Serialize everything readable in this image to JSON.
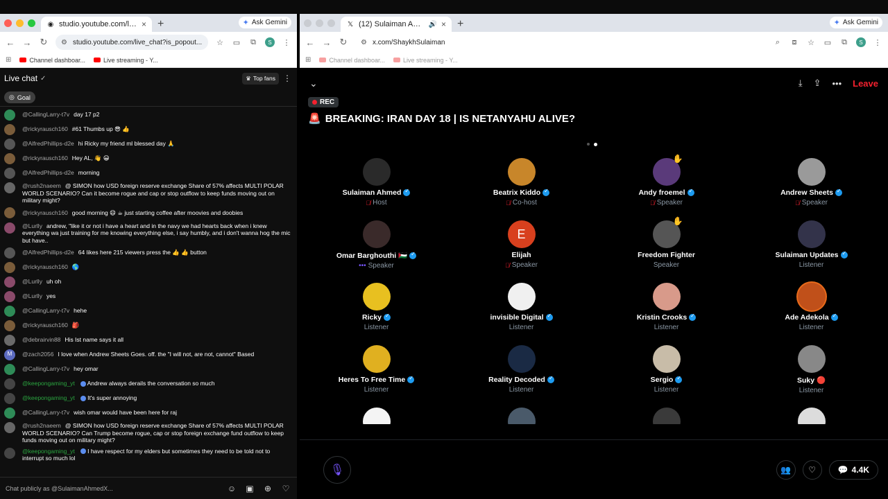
{
  "left_window": {
    "tab": {
      "title": "studio.youtube.com/live_cha",
      "close": "×"
    },
    "new_tab": "+",
    "gemini": "Ask Gemini",
    "url": "studio.youtube.com/live_chat?is_popout...",
    "bookmarks": [
      "Channel dashboar...",
      "Live streaming - Y..."
    ]
  },
  "right_window": {
    "tab": {
      "title": "(12) Sulaiman Ahmed (@S",
      "close": "×"
    },
    "new_tab": "+",
    "gemini": "Ask Gemini",
    "url": "x.com/ShaykhSulaiman",
    "bookmarks": [
      "Channel dashboar...",
      "Live streaming - Y..."
    ]
  },
  "chat": {
    "title": "Live chat",
    "top_fans": "Top fans",
    "goal": "Goal",
    "input_placeholder": "Chat publicly as @SulaimanAhmedX...",
    "badge_count": "1",
    "messages": [
      {
        "author": "@CallingLarry-t7v",
        "text": "day 17 p2",
        "color": "#2e8b57"
      },
      {
        "author": "@rickyrausch160",
        "text": "#61 Thumbs up 😎 👍",
        "color": "#7a5c3a"
      },
      {
        "author": "@AlfredPhillips-d2e",
        "text": "hi Ricky my friend ml blessed day 🙏",
        "color": "#555"
      },
      {
        "author": "@rickyrausch160",
        "text": "Hey AL, 👋 😀",
        "color": "#7a5c3a"
      },
      {
        "author": "@AlfredPhillips-d2e",
        "text": "morning",
        "color": "#555"
      },
      {
        "author": "@rush2naeem",
        "text": "@ SIMON how USD foreign reserve exchange Share of 57% affects MULTI POLAR WORLD SCENARIO? Can it become rogue and cap or stop outflow to keep funds moving out on military might?",
        "color": "#666",
        "tall": true
      },
      {
        "author": "@rickyrausch160",
        "text": "good morning 😄 ☕ just starting coffee after moovies and doobies",
        "color": "#7a5c3a"
      },
      {
        "author": "@Lurlly",
        "text": "andrew, \"like it or not i have a heart and in the navy we had hearts back when i knew everything wa just training for me knowing everything else, i say humbly, and i don't wanna hog the mic but have..",
        "color": "#8a4a6a",
        "tall": true
      },
      {
        "author": "@AlfredPhillips-d2e",
        "text": "64 likes here 215 viewers press the 👍 👍 button",
        "color": "#555"
      },
      {
        "author": "@rickyrausch160",
        "text": "🌎",
        "color": "#7a5c3a"
      },
      {
        "author": "@Lurlly",
        "text": "uh oh",
        "color": "#8a4a6a"
      },
      {
        "author": "@Lurlly",
        "text": "yes",
        "color": "#8a4a6a"
      },
      {
        "author": "@CallingLarry-t7v",
        "text": "hehe",
        "color": "#2e8b57"
      },
      {
        "author": "@rickyrausch160",
        "text": "🎒",
        "color": "#7a5c3a"
      },
      {
        "author": "@debrairvin88",
        "text": "His Ist name says it all",
        "color": "#6a6a6a"
      },
      {
        "author": "@zach2056",
        "text": "I love when Andrew Sheets Goes. off. the \"I will not, are not, cannot\" Based",
        "color": "#5c6bc0",
        "initial": "M"
      },
      {
        "author": "@CallingLarry-t7v",
        "text": "hey omar",
        "color": "#2e8b57"
      },
      {
        "author": "@keepongaming_yt",
        "text": "Andrew always derails the conversation so much",
        "color": "#444",
        "green": true
      },
      {
        "author": "@keepongaming_yt",
        "text": "It's super annoying",
        "color": "#444",
        "green": true
      },
      {
        "author": "@CallingLarry-t7v",
        "text": "wish omar would have been here for raj",
        "color": "#2e8b57"
      },
      {
        "author": "@rush2naeem",
        "text": "@ SIMON how USD foreign reserve exchange Share of 57% affects MULTI POLAR WORLD SCENARIO? Can Trump become rogue, cap or stop foreign exchange fund outflow to keep funds moving out on military might?",
        "color": "#666",
        "tall": true
      },
      {
        "author": "@keepongaming_yt",
        "text": "I have respect for my elders but sometimes they need to be told not to interrupt so much lol",
        "color": "#444",
        "green": true,
        "tall": true
      }
    ]
  },
  "space": {
    "rec": "REC",
    "leave": "Leave",
    "title": "BREAKING: IRAN DAY 18 | IS NETANYAHU ALIVE?",
    "title_emoji": "🚨",
    "listener_count": "4.4K",
    "people": [
      {
        "name": "Sulaiman Ahmed",
        "role": "Host",
        "verified": true,
        "muted": true,
        "color": "#2a2a2a"
      },
      {
        "name": "Beatrix Kiddo",
        "role": "Co-host",
        "verified": true,
        "muted": true,
        "color": "#c8862a"
      },
      {
        "name": "Andy froemel",
        "role": "Speaker",
        "verified": true,
        "muted": true,
        "color": "#5a3a7a",
        "hand": true
      },
      {
        "name": "Andrew Sheets",
        "role": "Speaker",
        "verified": true,
        "muted": true,
        "color": "#9a9a9a"
      },
      {
        "name": "Omar Barghouthi 🇵🇸",
        "role": "Speaker",
        "verified": true,
        "speaking": true,
        "color": "#3a2a2a"
      },
      {
        "name": "Elijah",
        "role": "Speaker",
        "verified": false,
        "muted": true,
        "color": "#d8401e",
        "initial": "E"
      },
      {
        "name": "Freedom Fighter",
        "role": "Speaker",
        "verified": false,
        "color": "#555",
        "hand": true
      },
      {
        "name": "Sulaiman Updates",
        "role": "Listener",
        "verified": true,
        "color": "#33334a"
      },
      {
        "name": "Ricky",
        "role": "Listener",
        "verified": true,
        "color": "#e8c020"
      },
      {
        "name": "invisible Digital",
        "role": "Listener",
        "verified": true,
        "color": "#f0f0f0"
      },
      {
        "name": "Kristin Crooks",
        "role": "Listener",
        "verified": true,
        "color": "#d89a8a"
      },
      {
        "name": "Ade Adekola",
        "role": "Listener",
        "verified": true,
        "color": "#c0501a",
        "ring": true
      },
      {
        "name": "Heres To Free Time",
        "role": "Listener",
        "verified": true,
        "color": "#e0b020"
      },
      {
        "name": "Reality Decoded",
        "role": "Listener",
        "verified": true,
        "color": "#1a2a44"
      },
      {
        "name": "Sergio",
        "role": "Listener",
        "verified": true,
        "color": "#c8bca8"
      },
      {
        "name": "Suky 🔴",
        "role": "Listener",
        "verified": false,
        "color": "#888"
      }
    ],
    "partial_colors": [
      "#f4f4f4",
      "#4a5a6a",
      "#3a3a3a",
      "#dcdcdc"
    ]
  }
}
